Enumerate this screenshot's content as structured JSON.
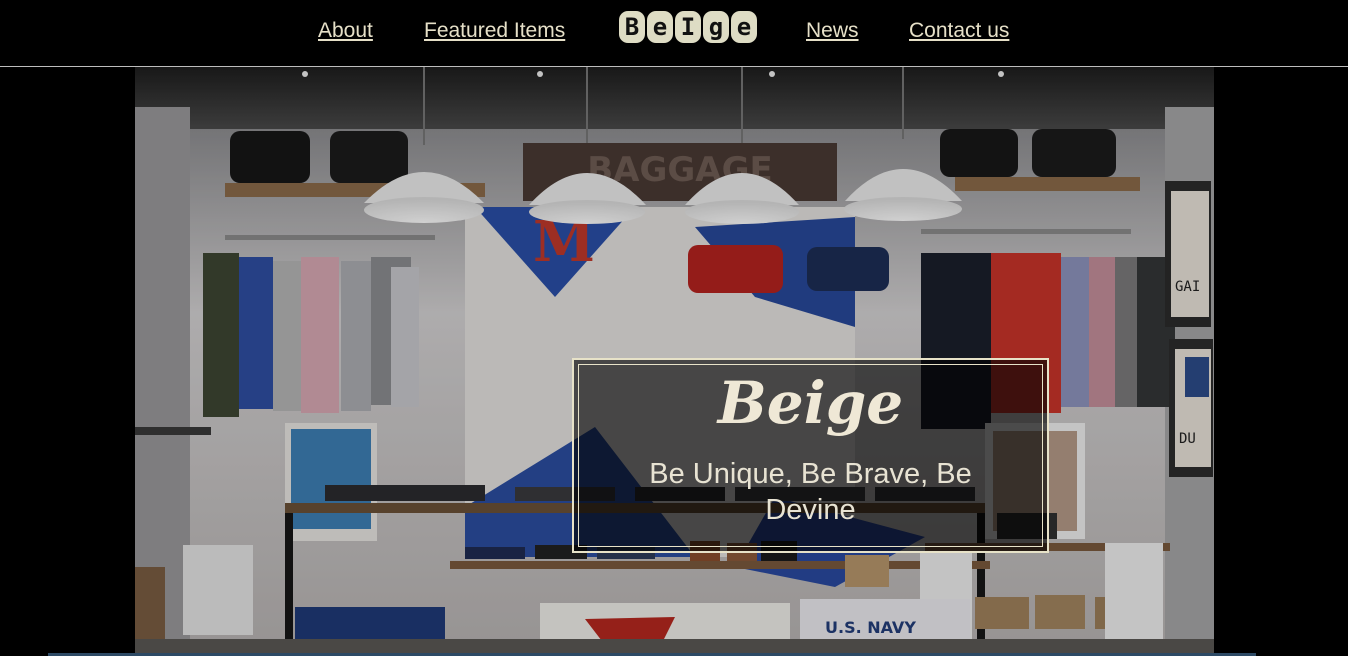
{
  "nav": {
    "items": [
      "About",
      "Featured Items",
      "News",
      "Contact us"
    ],
    "logo_letters": [
      "B",
      "e",
      "I",
      "g",
      "e"
    ]
  },
  "hero": {
    "title": "Beige",
    "tagline": "Be Unique, Be Brave, Be Devine",
    "sign_text": "BAGGAGE",
    "shirt_text": "U.S. NAVY",
    "poster_text_1": "GAI",
    "poster_text_2": "DU"
  }
}
